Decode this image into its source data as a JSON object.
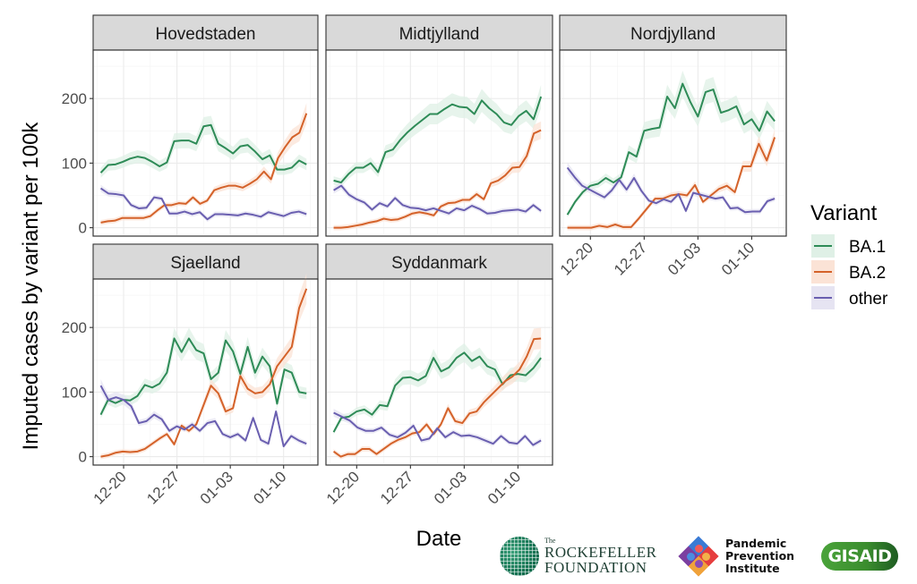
{
  "chart_data": {
    "type": "line",
    "title": "",
    "xlabel": "Date",
    "ylabel": "Imputed cases by variant per 100k",
    "ylim": [
      -13,
      275
    ],
    "xlim_days": [
      0,
      29.5
    ],
    "x_origin": "12-16",
    "y_ticks": [
      0,
      100,
      200
    ],
    "y_tick_labels": [
      "0",
      "100",
      "200"
    ],
    "x_ticks_days": [
      4,
      11,
      18,
      25
    ],
    "x_tick_labels": [
      "12-20",
      "12-27",
      "01-03",
      "01-10"
    ],
    "x_days": [
      1,
      2,
      3,
      4,
      5,
      6,
      7,
      8,
      9,
      10,
      11,
      12,
      13,
      14,
      15,
      16,
      17,
      18,
      19,
      20,
      21,
      22,
      23,
      24,
      25,
      26,
      27,
      28
    ],
    "grid": true,
    "legend": {
      "title": "Variant",
      "position": "right",
      "entries": [
        {
          "name": "BA.1",
          "color": "#2e8b57",
          "fill": "#dff0e6"
        },
        {
          "name": "BA.2",
          "color": "#d4622a",
          "fill": "#fbe3d6"
        },
        {
          "name": "other",
          "color": "#6a5fb0",
          "fill": "#e6e4f2"
        }
      ]
    },
    "panels": [
      {
        "name": "Hovedstaden",
        "series": [
          {
            "name": "BA.1",
            "values": [
              85,
              97,
              98,
              102,
              107,
              110,
              108,
              102,
              95,
              101,
              134,
              135,
              135,
              130,
              157,
              159,
              130,
              123,
              115,
              126,
              128,
              118,
              106,
              112,
              90,
              90,
              93,
              104,
              98
            ]
          },
          {
            "name": "BA.2",
            "values": [
              8,
              10,
              11,
              15,
              15,
              15,
              15,
              18,
              27,
              35,
              35,
              38,
              37,
              47,
              37,
              42,
              58,
              62,
              65,
              65,
              62,
              68,
              75,
              87,
              75,
              108,
              125,
              140,
              147,
              177
            ]
          },
          {
            "name": "other",
            "values": [
              61,
              53,
              52,
              50,
              35,
              30,
              31,
              47,
              45,
              22,
              22,
              25,
              21,
              24,
              13,
              21,
              21,
              20,
              19,
              22,
              20,
              17,
              24,
              21,
              18,
              23,
              25,
              21
            ]
          }
        ]
      },
      {
        "name": "Midtjylland",
        "series": [
          {
            "name": "BA.1",
            "values": [
              73,
              70,
              83,
              93,
              93,
              100,
              86,
              117,
              121,
              136,
              148,
              158,
              167,
              176,
              176,
              184,
              191,
              187,
              186,
              176,
              197,
              185,
              176,
              163,
              159,
              173,
              181,
              168,
              203
            ]
          },
          {
            "name": "BA.2",
            "values": [
              0,
              0,
              1,
              3,
              5,
              8,
              10,
              14,
              12,
              13,
              17,
              22,
              24,
              22,
              19,
              33,
              38,
              39,
              43,
              43,
              52,
              44,
              69,
              73,
              81,
              93,
              94,
              111,
              146,
              151
            ]
          },
          {
            "name": "other",
            "values": [
              58,
              65,
              51,
              44,
              39,
              28,
              38,
              33,
              46,
              35,
              31,
              30,
              27,
              30,
              26,
              22,
              30,
              27,
              34,
              29,
              22,
              23,
              26,
              27,
              28,
              25,
              35,
              26
            ]
          }
        ]
      },
      {
        "name": "Nordjylland",
        "series": [
          {
            "name": "BA.1",
            "values": [
              20,
              40,
              55,
              65,
              68,
              77,
              70,
              78,
              117,
              110,
              150,
              153,
              155,
              203,
              185,
              223,
              195,
              172,
              210,
              214,
              178,
              182,
              188,
              160,
              168,
              150,
              180,
              165
            ]
          },
          {
            "name": "BA.2",
            "values": [
              0,
              0,
              0,
              0,
              3,
              1,
              5,
              1,
              1,
              15,
              30,
              45,
              45,
              50,
              52,
              50,
              66,
              40,
              50,
              60,
              65,
              55,
              95,
              95,
              130,
              104,
              140
            ]
          },
          {
            "name": "other",
            "values": [
              93,
              78,
              65,
              59,
              53,
              47,
              58,
              74,
              59,
              77,
              57,
              42,
              38,
              44,
              40,
              52,
              26,
              54,
              51,
              48,
              45,
              47,
              30,
              31,
              24,
              25,
              25,
              41,
              45
            ]
          }
        ]
      },
      {
        "name": "Sjaelland",
        "series": [
          {
            "name": "BA.1",
            "values": [
              65,
              88,
              83,
              88,
              87,
              94,
              111,
              107,
              113,
              130,
              183,
              162,
              183,
              165,
              160,
              120,
              130,
              180,
              163,
              128,
              170,
              130,
              155,
              140,
              82,
              135,
              130,
              100,
              98
            ]
          },
          {
            "name": "BA.2",
            "values": [
              0,
              2,
              6,
              8,
              7,
              8,
              12,
              20,
              28,
              35,
              19,
              48,
              40,
              50,
              80,
              110,
              98,
              70,
              75,
              125,
              105,
              98,
              100,
              112,
              140,
              155,
              170,
              230,
              260
            ]
          },
          {
            "name": "other",
            "values": [
              110,
              88,
              92,
              88,
              78,
              52,
              55,
              65,
              58,
              40,
              47,
              42,
              50,
              40,
              52,
              55,
              35,
              30,
              35,
              25,
              60,
              26,
              20,
              70,
              16,
              32,
              25,
              20
            ]
          }
        ]
      },
      {
        "name": "Syddanmark",
        "series": [
          {
            "name": "BA.1",
            "values": [
              38,
              60,
              62,
              70,
              73,
              65,
              80,
              78,
              110,
              122,
              123,
              118,
              125,
              153,
              132,
              138,
              153,
              161,
              148,
              155,
              140,
              135,
              112,
              126,
              128,
              126,
              137,
              153
            ]
          },
          {
            "name": "BA.2",
            "values": [
              8,
              0,
              4,
              4,
              12,
              12,
              4,
              12,
              20,
              26,
              30,
              36,
              38,
              50,
              35,
              50,
              75,
              55,
              52,
              67,
              70,
              84,
              95,
              106,
              117,
              124,
              135,
              155,
              182,
              183
            ]
          },
          {
            "name": "other",
            "values": [
              68,
              62,
              56,
              45,
              40,
              40,
              45,
              34,
              30,
              37,
              48,
              25,
              28,
              44,
              30,
              38,
              32,
              33,
              30,
              25,
              20,
              32,
              22,
              20,
              32,
              18,
              25
            ]
          }
        ]
      }
    ]
  },
  "logos": {
    "rockefeller_the": "The",
    "rockefeller_line1": "ROCKEFELLER",
    "rockefeller_line2": "FOUNDATION",
    "ppi_line1": "Pandemic",
    "ppi_line2": "Prevention",
    "ppi_line3": "Institute",
    "gisaid": "GISAID"
  }
}
